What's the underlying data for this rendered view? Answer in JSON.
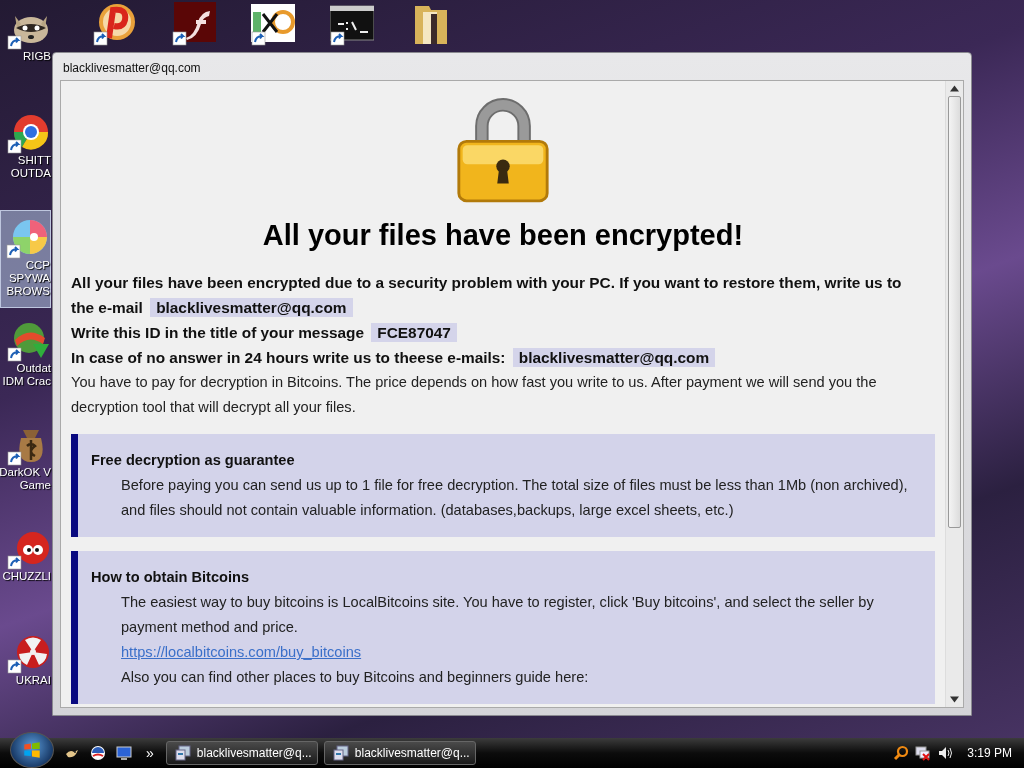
{
  "desktop": {
    "icons": [
      {
        "label_lines": [
          "RIGB"
        ],
        "selected": false
      },
      {
        "label_lines": [
          "SHITT",
          "OUTDA"
        ],
        "selected": false
      },
      {
        "label_lines": [
          "CCP",
          "SPYWA",
          "BROWS"
        ],
        "selected": true
      },
      {
        "label_lines": [
          "Outdat",
          "IDM Crac"
        ],
        "selected": false
      },
      {
        "label_lines": [
          "DarkOK V",
          "Game"
        ],
        "selected": false
      },
      {
        "label_lines": [
          "CHUZZLI"
        ],
        "selected": false
      },
      {
        "label_lines": [
          "UKRAI"
        ],
        "selected": false
      }
    ]
  },
  "window": {
    "title": "blacklivesmatter@qq.com",
    "heading": "All your files have been encrypted!",
    "contact_lines": [
      {
        "text": "All your files have been encrypted due to a security problem with your PC. If you want to restore them, write us to the e-mail",
        "highlight": "blacklivesmatter@qq.com"
      },
      {
        "text": "Write this ID in the title of your message",
        "highlight": "FCE87047"
      },
      {
        "text": "In case of no answer in 24 hours write us to theese e-mails:",
        "highlight": "blacklivesmatter@qq.com"
      }
    ],
    "payment_note": "You have to pay for decryption in Bitcoins. The price depends on how fast you write to us. After payment we will send you the decryption tool that will decrypt all your files.",
    "sections": [
      {
        "title": "Free decryption as guarantee",
        "paragraphs": [
          {
            "kind": "text",
            "text": "Before paying you can send us up to 1 file for free decryption. The total size of files must be less than 1Mb (non archived), and files should not contain valuable information. (databases,backups, large excel sheets, etc.)"
          }
        ]
      },
      {
        "title": "How to obtain Bitcoins",
        "paragraphs": [
          {
            "kind": "text",
            "text": "The easiest way to buy bitcoins is LocalBitcoins site. You have to register, click 'Buy bitcoins', and select the seller by payment method and price."
          },
          {
            "kind": "link",
            "text": "https://localbitcoins.com/buy_bitcoins"
          },
          {
            "kind": "text",
            "text": "Also you can find other places to buy Bitcoins and beginners guide here:"
          }
        ]
      }
    ]
  },
  "taskbar": {
    "overflow_glyph": "»",
    "tasks": [
      {
        "label": "blacklivesmatter@q..."
      },
      {
        "label": "blacklivesmatter@q..."
      }
    ],
    "clock": "3:19 PM"
  }
}
